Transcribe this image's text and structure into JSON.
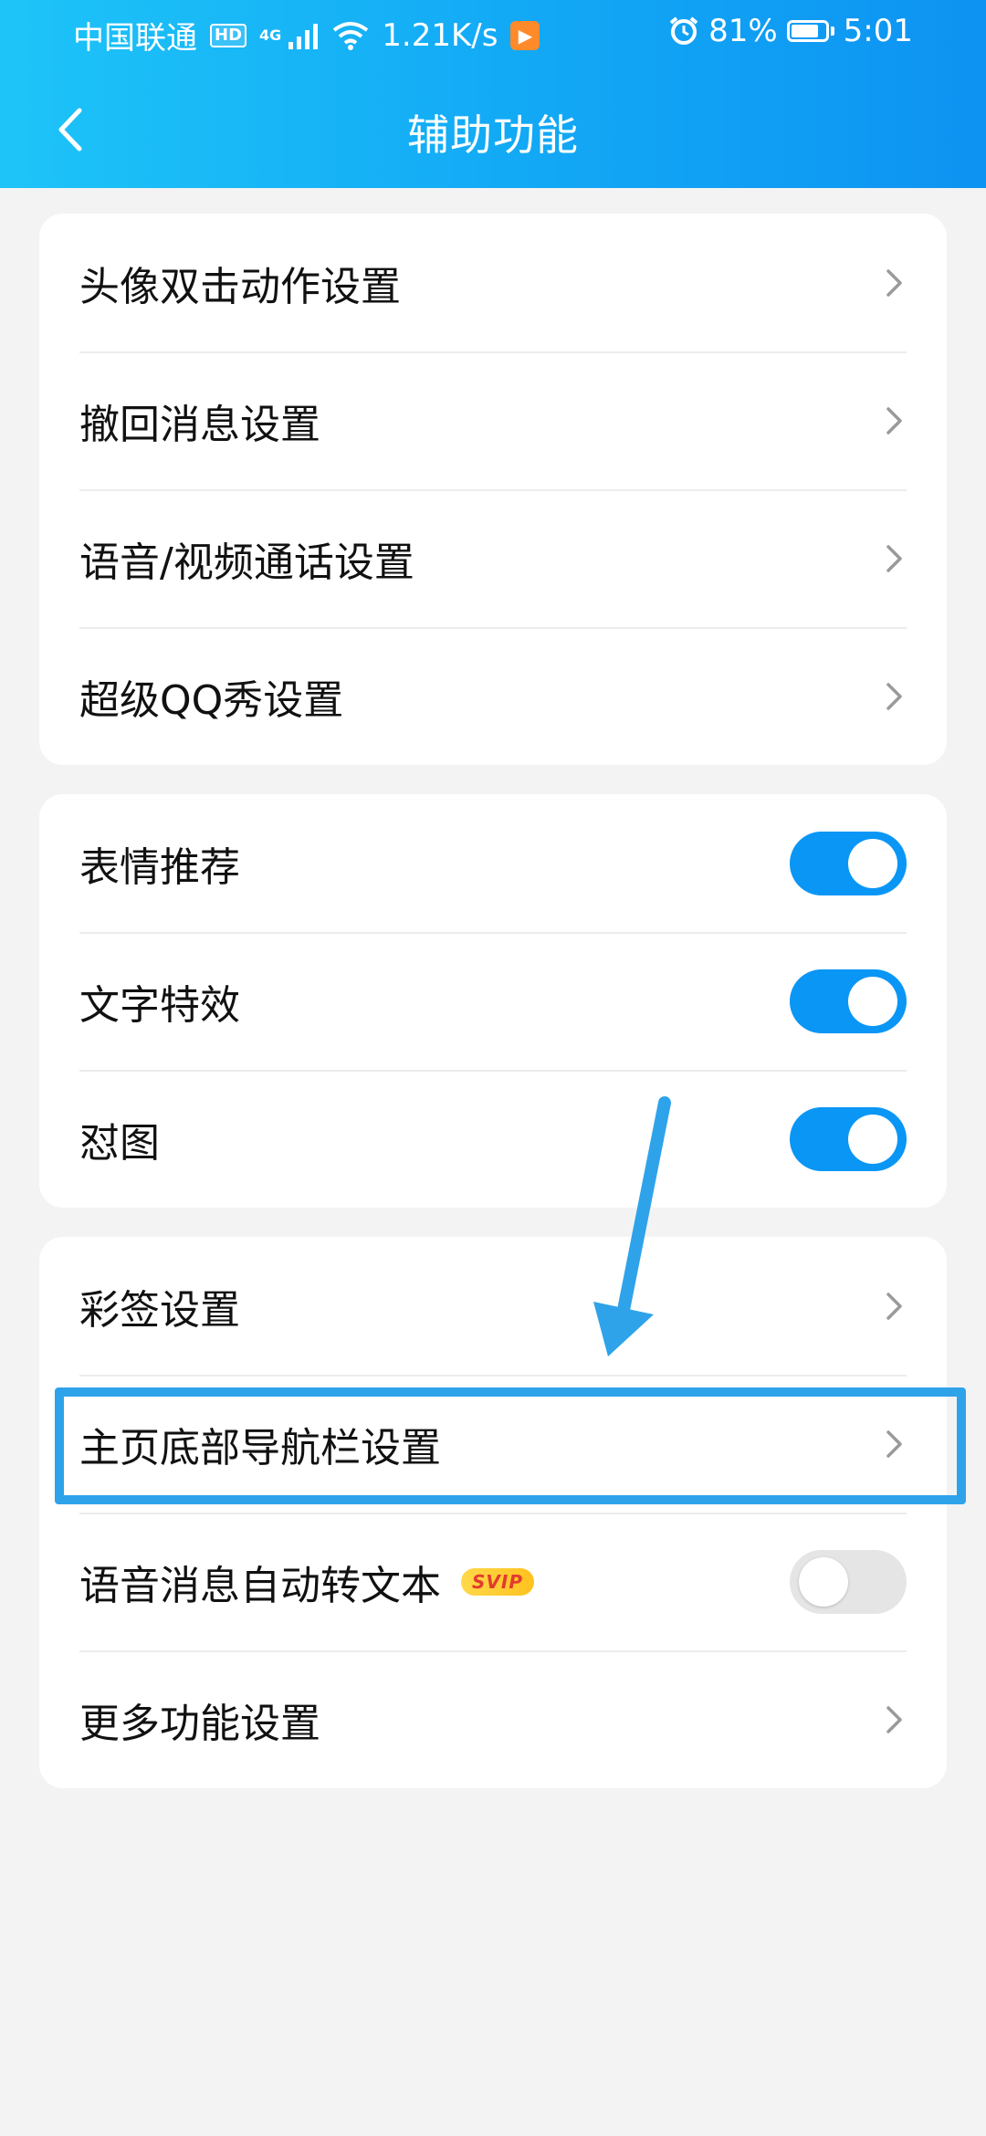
{
  "status_bar": {
    "carrier": "中国联通",
    "hd": "HD",
    "network_type": "4G",
    "speed": "1.21K/s",
    "battery_percent": "81%",
    "battery_level": 0.81,
    "time": "5:01"
  },
  "nav": {
    "title": "辅助功能"
  },
  "group1": [
    {
      "label": "头像双击动作设置"
    },
    {
      "label": "撤回消息设置"
    },
    {
      "label": "语音/视频通话设置"
    },
    {
      "label": "超级QQ秀设置"
    }
  ],
  "group2": [
    {
      "label": "表情推荐",
      "on": true
    },
    {
      "label": "文字特效",
      "on": true
    },
    {
      "label": "怼图",
      "on": true
    }
  ],
  "group3": {
    "caiqian": "彩签设置",
    "bottom_nav": "主页底部导航栏设置",
    "voice_to_text": "语音消息自动转文本",
    "voice_to_text_on": false,
    "svip_badge": "SVIP",
    "more": "更多功能设置"
  },
  "colors": {
    "header_start": "#1ec4f8",
    "header_end": "#0d93f2",
    "toggle_on": "#0a96f5",
    "highlight": "#2ea3ea"
  }
}
